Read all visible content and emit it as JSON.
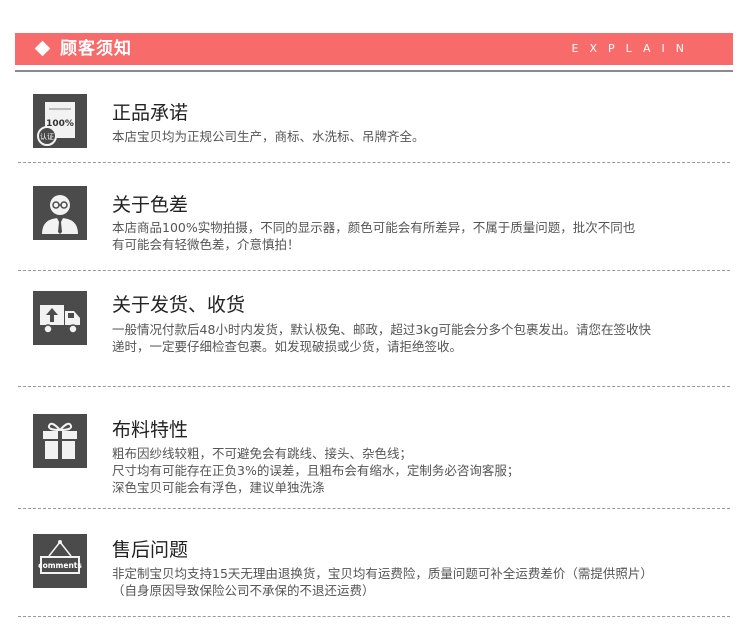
{
  "header": {
    "title": "顾客须知",
    "subtitle": "EXPLAIN",
    "color": "#f76b6b"
  },
  "sections": [
    {
      "icon": "certificate-icon",
      "icon_text_top": "100%",
      "icon_text_badge": "认证",
      "title": "正品承诺",
      "lines": [
        "本店宝贝均为正规公司生产，商标、水洗标、吊牌齐全。"
      ]
    },
    {
      "icon": "person-glasses-icon",
      "title": "关于色差",
      "lines": [
        "本店商品100%实物拍摄，不同的显示器，颜色可能会有所差异，不属于质量问题，批次不同也",
        "有可能会有轻微色差，介意慎拍！"
      ]
    },
    {
      "icon": "delivery-truck-icon",
      "title": "关于发货、收货",
      "lines": [
        "一般情况付款后48小时内发货，默认极兔、邮政，超过3kg可能会分多个包裹发出。请您在签收快",
        "递时，一定要仔细检查包裹。如发现破损或少货，请拒绝签收。"
      ]
    },
    {
      "icon": "gift-icon",
      "title": "布料特性",
      "lines": [
        "粗布因纱线较粗，不可避免会有跳线、接头、杂色线；",
        "尺寸均有可能存在正负3%的误差，且粗布会有缩水，定制务必咨询客服；",
        "深色宝贝可能会有浮色，建议单独洗涤"
      ]
    },
    {
      "icon": "comments-sign-icon",
      "icon_text": "comments",
      "title": "售后问题",
      "lines": [
        "非定制宝贝均支持15天无理由退换货，宝贝均有运费险，质量问题可补全运费差价（需提供照片）",
        "（自身原因导致保险公司不承保的不退还运费）"
      ]
    }
  ]
}
